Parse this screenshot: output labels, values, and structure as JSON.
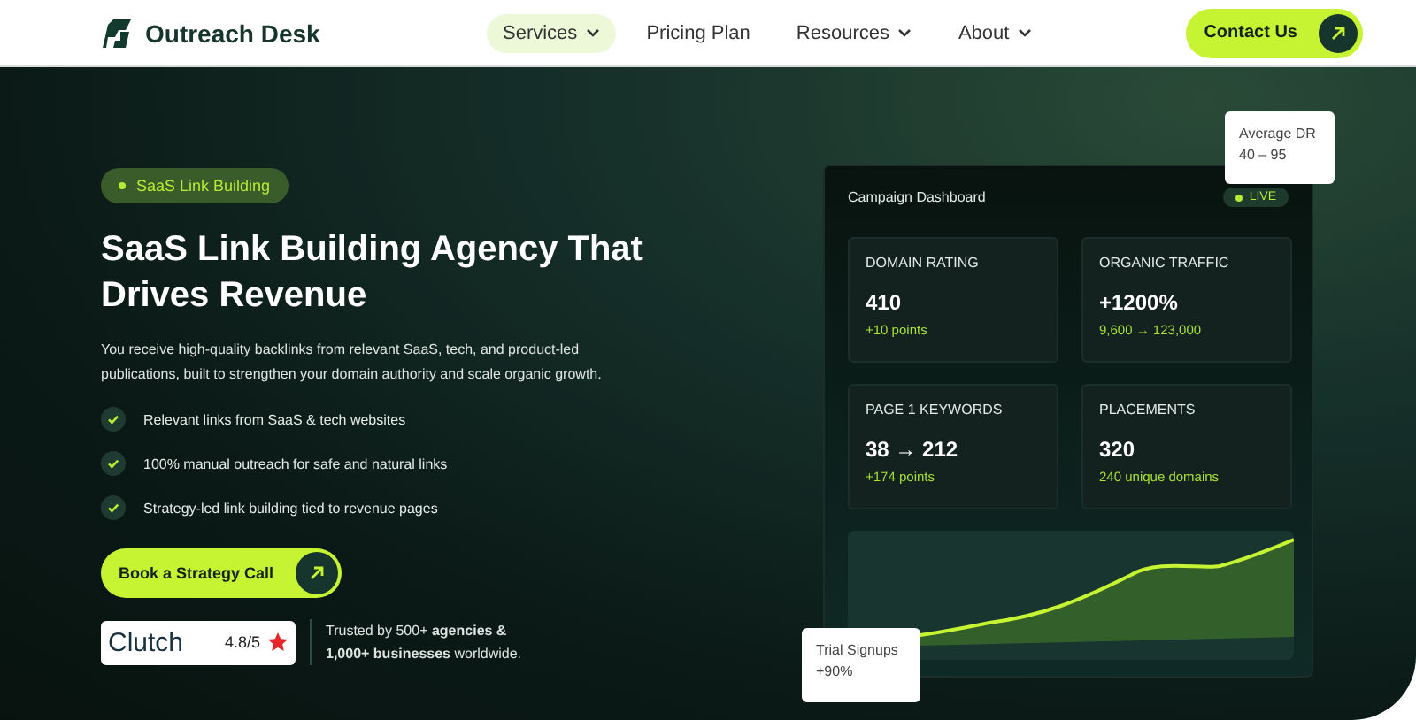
{
  "header": {
    "logo": "Outreach Desk",
    "nav": [
      {
        "label": "Services",
        "selected": true,
        "dropdown": true
      },
      {
        "label": "Pricing Plan",
        "selected": false,
        "dropdown": false
      },
      {
        "label": "Resources",
        "selected": false,
        "dropdown": true
      },
      {
        "label": "About",
        "selected": false,
        "dropdown": true
      }
    ],
    "cta": "Contact Us"
  },
  "hero": {
    "badge": "SaaS Link Building",
    "title": "SaaS Link Building Agency That Drives Revenue",
    "description": "You receive high-quality backlinks from relevant SaaS, tech, and product-led publications, built to strengthen your domain authority and scale organic growth.",
    "points": [
      "Relevant links from SaaS & tech websites",
      "100% manual outreach for safe and natural links",
      "Strategy-led link building tied to revenue pages"
    ],
    "button": "Book a Strategy Call",
    "rating": {
      "brand": "Clutch",
      "score": "4.8/5"
    },
    "trust": "Trusted by 500+ **agencies &** **1,000+ businesses** worldwide."
  },
  "dashboard": {
    "title": "Campaign Dashboard",
    "status": "LIVE",
    "stats": [
      {
        "label": "DOMAIN RATING",
        "value": "410",
        "note": "+10 points"
      },
      {
        "label": "ORGANIC TRAFFIC",
        "value": "+1200%",
        "note": "9,600 → 123,000"
      },
      {
        "label": "PAGE 1 KEYWORDS",
        "value": "38 → 212",
        "note": "+174 points"
      },
      {
        "label": "PLACEMENTS",
        "value": "320",
        "note": "240 unique domains"
      }
    ],
    "tooltips": [
      {
        "label": "Average DR",
        "value": "40 – 95"
      },
      {
        "label": "Trial Signups",
        "value": "+90%"
      }
    ]
  }
}
